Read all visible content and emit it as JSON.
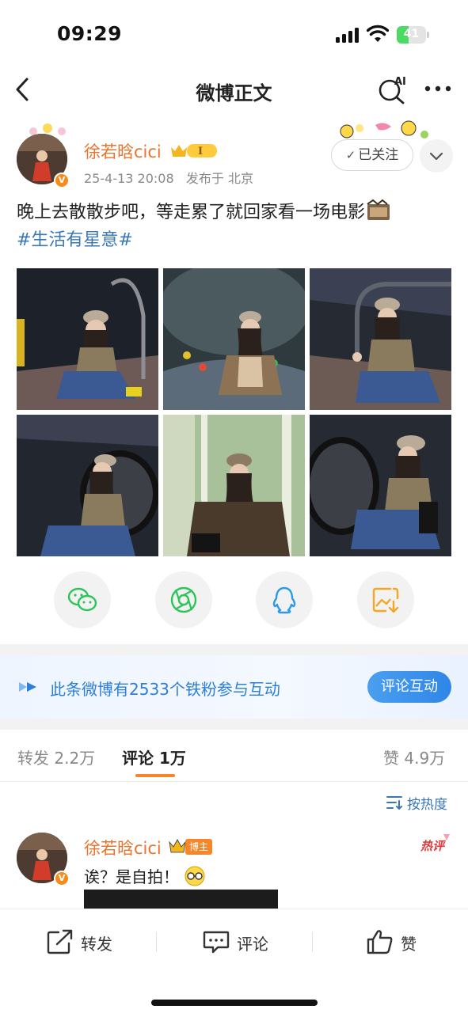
{
  "status_bar": {
    "time": "09:29",
    "battery": "41"
  },
  "nav": {
    "title": "微博正文"
  },
  "author": {
    "name": "徐若晗cici",
    "timestamp": "25-4-13 20:08",
    "location": "发布于 北京",
    "follow_label": "已关注"
  },
  "post": {
    "text": "晚上去散散步吧，等走累了就回家看一场电影",
    "topic": "#生活有星意#"
  },
  "fan_banner": {
    "text": "此条微博有2533个铁粉参与互动",
    "button_label": "评论互动"
  },
  "tabs": {
    "repost_label": "转发",
    "repost_count": "2.2万",
    "comment_label": "评论",
    "comment_count": "1万",
    "like_label": "赞",
    "like_count": "4.9万"
  },
  "sort": {
    "label": "按热度"
  },
  "comment": {
    "author": "徐若晗cici",
    "role_badge": "博主",
    "text": "诶？是自拍！"
  },
  "bottom_bar": {
    "repost_label": "转发",
    "comment_label": "评论",
    "like_label": "赞"
  },
  "icons": {
    "back": "chevron-left-icon",
    "ai_search": "ai-search-icon",
    "more": "more-horizontal-icon",
    "wechat": "wechat-icon",
    "moments": "moments-icon",
    "qq": "qq-icon",
    "save_image": "save-image-icon"
  },
  "colors": {
    "accent_orange": "#e8732b",
    "link_blue": "#3a77b6",
    "wechat_green": "#2ec45a",
    "qq_blue": "#2b9be8",
    "save_orange": "#f5a623"
  }
}
